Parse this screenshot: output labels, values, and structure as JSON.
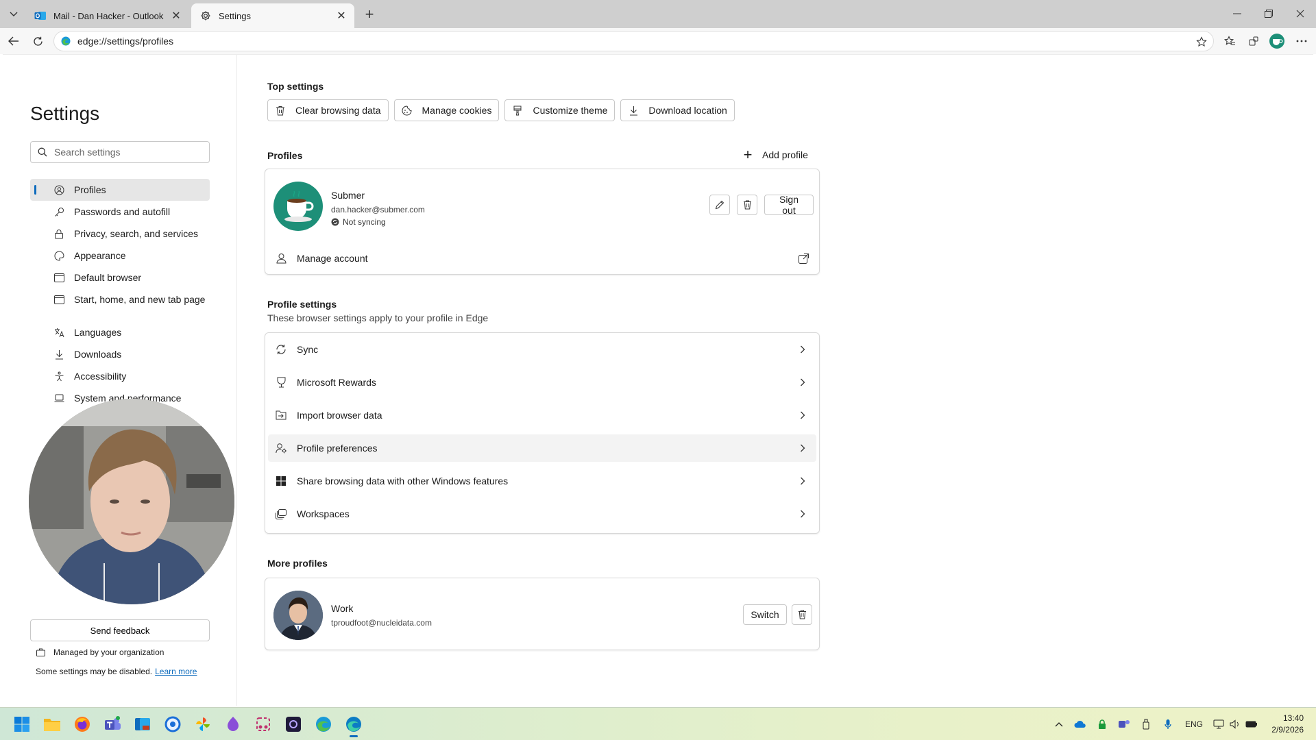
{
  "browser": {
    "tabs": [
      {
        "title": "Mail - Dan Hacker - Outlook",
        "icon": "outlook-icon"
      },
      {
        "title": "Settings",
        "icon": "gear-icon"
      }
    ],
    "address": "edge://settings/profiles"
  },
  "sidebar": {
    "title": "Settings",
    "search_placeholder": "Search settings",
    "items": [
      {
        "label": "Profiles",
        "icon": "profile-icon"
      },
      {
        "label": "Passwords and autofill",
        "icon": "key-icon"
      },
      {
        "label": "Privacy, search, and services",
        "icon": "lock-icon"
      },
      {
        "label": "Appearance",
        "icon": "appearance-icon"
      },
      {
        "label": "Default browser",
        "icon": "browser-icon"
      },
      {
        "label": "Start, home, and new tab page",
        "icon": "home-icon"
      },
      {
        "label": "Languages",
        "icon": "languages-icon"
      },
      {
        "label": "Downloads",
        "icon": "download-icon"
      },
      {
        "label": "Accessibility",
        "icon": "accessibility-icon"
      },
      {
        "label": "System and performance",
        "icon": "laptop-icon"
      }
    ],
    "feedback_label": "Send feedback",
    "managed_label": "Managed by your organization",
    "disabled_note": "Some settings may be disabled.",
    "learn_more": "Learn more"
  },
  "main": {
    "top_settings": {
      "heading": "Top settings",
      "buttons": [
        {
          "label": "Clear browsing data",
          "icon": "trash-icon"
        },
        {
          "label": "Manage cookies",
          "icon": "cookie-icon"
        },
        {
          "label": "Customize theme",
          "icon": "brush-icon"
        },
        {
          "label": "Download location",
          "icon": "download-icon"
        }
      ]
    },
    "profiles": {
      "heading": "Profiles",
      "add_label": "Add profile",
      "current": {
        "name": "Submer",
        "email": "dan.hacker@submer.com",
        "sync_status": "Not syncing",
        "sign_out_label": "Sign out"
      },
      "manage_account": "Manage account"
    },
    "profile_settings": {
      "heading": "Profile settings",
      "description": "These browser settings apply to your profile in Edge",
      "rows": [
        {
          "label": "Sync",
          "icon": "sync-icon"
        },
        {
          "label": "Microsoft Rewards",
          "icon": "rewards-icon"
        },
        {
          "label": "Import browser data",
          "icon": "import-icon"
        },
        {
          "label": "Profile preferences",
          "icon": "profile-preferences-icon"
        },
        {
          "label": "Share browsing data with other Windows features",
          "icon": "windows-icon"
        },
        {
          "label": "Workspaces",
          "icon": "workspaces-icon"
        }
      ]
    },
    "more_profiles": {
      "heading": "More profiles",
      "profile": {
        "name": "Work",
        "email": "tproudfoot@nucleidata.com",
        "switch_label": "Switch"
      }
    }
  },
  "taskbar": {
    "language": "ENG",
    "time": "13:40",
    "date": "2/9/2026"
  },
  "colors": {
    "accent": "#0f6cbd",
    "profile_avatar_bg": "#1d8f78"
  }
}
